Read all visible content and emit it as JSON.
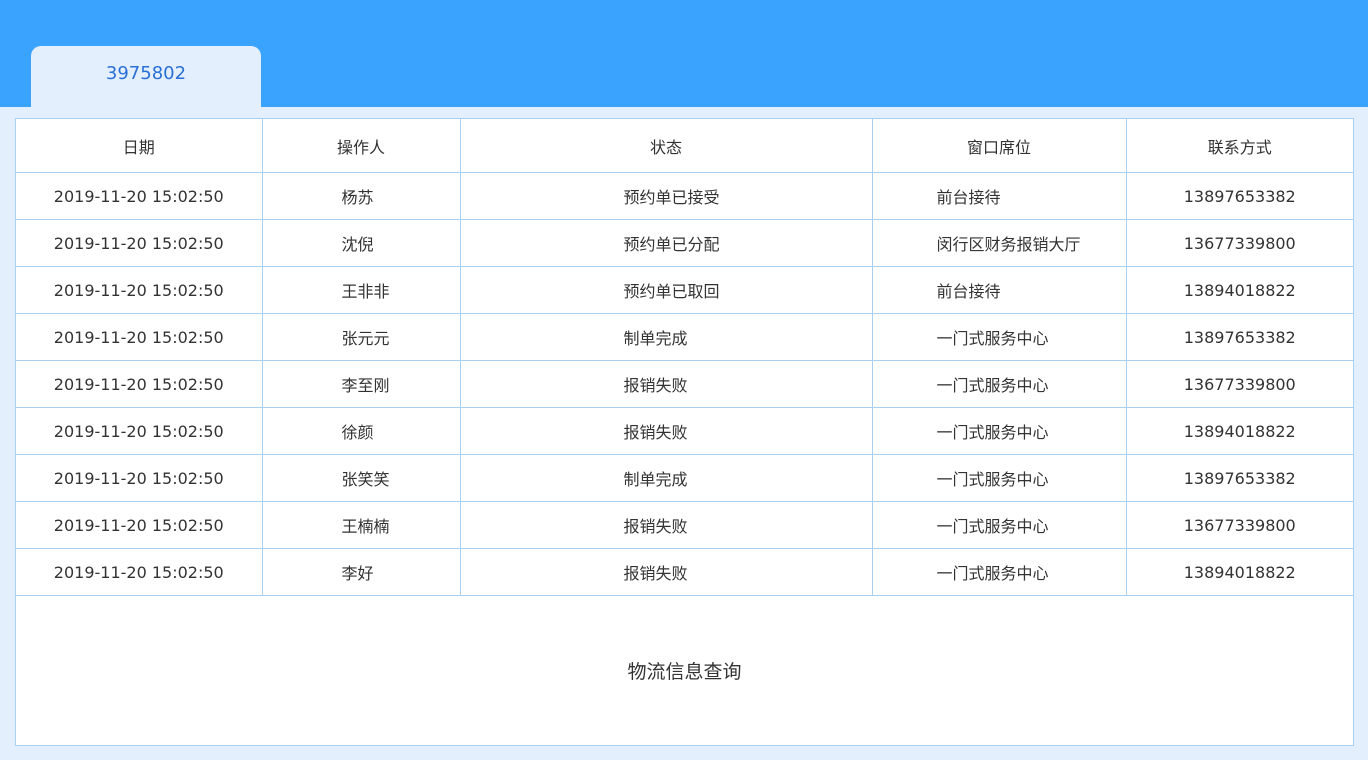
{
  "tab": {
    "label": "3975802"
  },
  "table": {
    "headers": [
      "日期",
      "操作人",
      "状态",
      "窗口席位",
      "联系方式"
    ],
    "rows": [
      {
        "date": "2019-11-20  15:02:50",
        "operator": "杨苏",
        "status": "预约单已接受",
        "window": "前台接待",
        "phone": "13897653382"
      },
      {
        "date": "2019-11-20  15:02:50",
        "operator": "沈倪",
        "status": "预约单已分配",
        "window": "闵行区财务报销大厅",
        "phone": "13677339800"
      },
      {
        "date": "2019-11-20  15:02:50",
        "operator": "王非非",
        "status": "预约单已取回",
        "window": "前台接待",
        "phone": "13894018822"
      },
      {
        "date": "2019-11-20  15:02:50",
        "operator": "张元元",
        "status": "制单完成",
        "window": "一门式服务中心",
        "phone": "13897653382"
      },
      {
        "date": "2019-11-20  15:02:50",
        "operator": "李至刚",
        "status": "报销失败",
        "window": "一门式服务中心",
        "phone": "13677339800"
      },
      {
        "date": "2019-11-20  15:02:50",
        "operator": "徐颜",
        "status": "报销失败",
        "window": "一门式服务中心",
        "phone": "13894018822"
      },
      {
        "date": "2019-11-20  15:02:50",
        "operator": "张笑笑",
        "status": "制单完成",
        "window": "一门式服务中心",
        "phone": "13897653382"
      },
      {
        "date": "2019-11-20  15:02:50",
        "operator": "王楠楠",
        "status": "报销失败",
        "window": "一门式服务中心",
        "phone": "13677339800"
      },
      {
        "date": "2019-11-20  15:02:50",
        "operator": "李好",
        "status": "报销失败",
        "window": "一门式服务中心",
        "phone": "13894018822"
      }
    ]
  },
  "footer": {
    "link_label": "物流信息查询"
  },
  "colors": {
    "header_blue": "#3aa3fd",
    "background": "#e3effd",
    "border": "#a9d0ef",
    "tab_text": "#2a6fd6"
  }
}
